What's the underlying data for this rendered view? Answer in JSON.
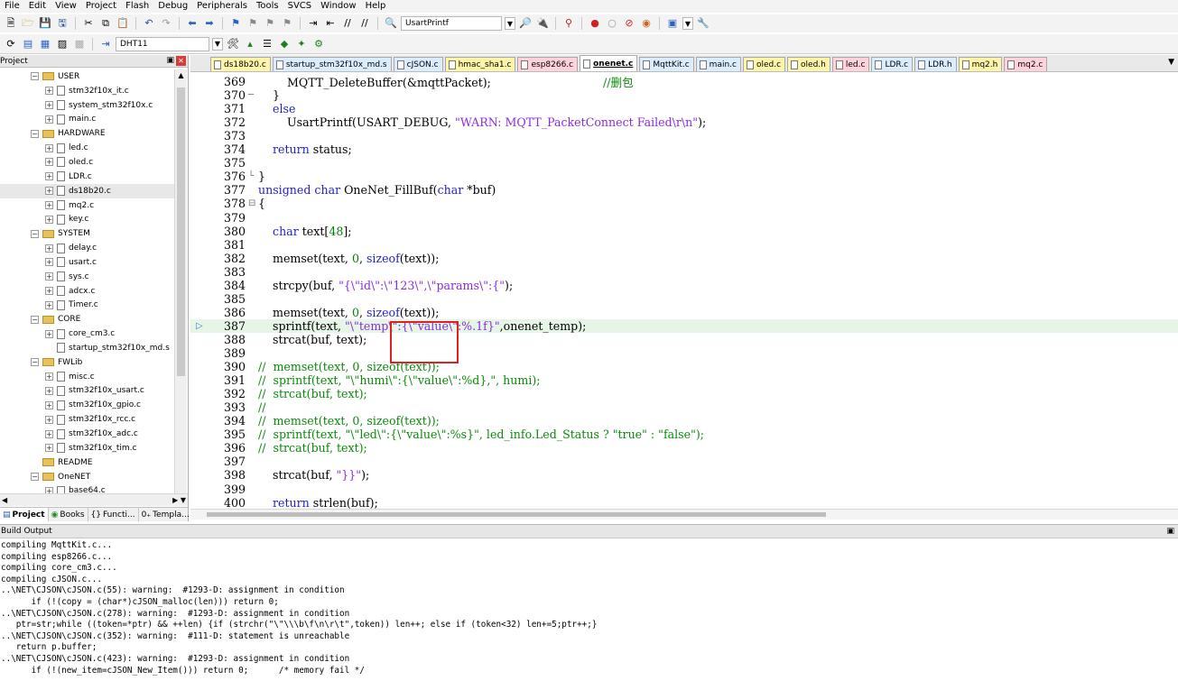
{
  "menu": [
    "File",
    "Edit",
    "View",
    "Project",
    "Flash",
    "Debug",
    "Peripherals",
    "Tools",
    "SVCS",
    "Window",
    "Help"
  ],
  "toolbar": {
    "find_combo": "UsartPrintf",
    "target_combo": "DHT11"
  },
  "project": {
    "title": "Project",
    "tree": [
      {
        "label": "USER",
        "type": "group",
        "level": 0,
        "expander": "−"
      },
      {
        "label": "stm32f10x_it.c",
        "type": "file",
        "level": 1,
        "expander": "+"
      },
      {
        "label": "system_stm32f10x.c",
        "type": "file",
        "level": 1,
        "expander": "+"
      },
      {
        "label": "main.c",
        "type": "file",
        "level": 1,
        "expander": "+"
      },
      {
        "label": "HARDWARE",
        "type": "group",
        "level": 0,
        "expander": "−"
      },
      {
        "label": "led.c",
        "type": "file",
        "level": 1,
        "expander": "+"
      },
      {
        "label": "oled.c",
        "type": "file",
        "level": 1,
        "expander": "+"
      },
      {
        "label": "LDR.c",
        "type": "file",
        "level": 1,
        "expander": "+"
      },
      {
        "label": "ds18b20.c",
        "type": "file",
        "level": 1,
        "expander": "+",
        "selected": true
      },
      {
        "label": "mq2.c",
        "type": "file",
        "level": 1,
        "expander": "+"
      },
      {
        "label": "key.c",
        "type": "file",
        "level": 1,
        "expander": "+"
      },
      {
        "label": "SYSTEM",
        "type": "group",
        "level": 0,
        "expander": "−"
      },
      {
        "label": "delay.c",
        "type": "file",
        "level": 1,
        "expander": "+"
      },
      {
        "label": "usart.c",
        "type": "file",
        "level": 1,
        "expander": "+"
      },
      {
        "label": "sys.c",
        "type": "file",
        "level": 1,
        "expander": "+"
      },
      {
        "label": "adcx.c",
        "type": "file",
        "level": 1,
        "expander": "+"
      },
      {
        "label": "Timer.c",
        "type": "file",
        "level": 1,
        "expander": "+"
      },
      {
        "label": "CORE",
        "type": "group",
        "level": 0,
        "expander": "−"
      },
      {
        "label": "core_cm3.c",
        "type": "file",
        "level": 1,
        "expander": "+"
      },
      {
        "label": "startup_stm32f10x_md.s",
        "type": "file",
        "level": 1,
        "expander": ""
      },
      {
        "label": "FWLib",
        "type": "group",
        "level": 0,
        "expander": "−"
      },
      {
        "label": "misc.c",
        "type": "file",
        "level": 1,
        "expander": "+"
      },
      {
        "label": "stm32f10x_usart.c",
        "type": "file",
        "level": 1,
        "expander": "+"
      },
      {
        "label": "stm32f10x_gpio.c",
        "type": "file",
        "level": 1,
        "expander": "+"
      },
      {
        "label": "stm32f10x_rcc.c",
        "type": "file",
        "level": 1,
        "expander": "+"
      },
      {
        "label": "stm32f10x_adc.c",
        "type": "file",
        "level": 1,
        "expander": "+"
      },
      {
        "label": "stm32f10x_tim.c",
        "type": "file",
        "level": 1,
        "expander": "+"
      },
      {
        "label": "README",
        "type": "group",
        "level": 0,
        "expander": ""
      },
      {
        "label": "OneNET",
        "type": "group",
        "level": 0,
        "expander": "−"
      },
      {
        "label": "base64.c",
        "type": "file",
        "level": 1,
        "expander": "+"
      }
    ],
    "tabs": [
      "Project",
      "Books",
      "Functi...",
      "Templa..."
    ]
  },
  "editor": {
    "tabs": [
      {
        "label": "ds18b20.c",
        "color": "#fff5a8"
      },
      {
        "label": "startup_stm32f10x_md.s",
        "color": "#dcecff"
      },
      {
        "label": "cJSON.c",
        "color": "#dcecff"
      },
      {
        "label": "hmac_sha1.c",
        "color": "#fff5a8"
      },
      {
        "label": "esp8266.c",
        "color": "#ffd2dc"
      },
      {
        "label": "onenet.c",
        "color": "#ffffff",
        "active": true
      },
      {
        "label": "MqttKit.c",
        "color": "#dcecff"
      },
      {
        "label": "main.c",
        "color": "#dcecff"
      },
      {
        "label": "oled.c",
        "color": "#fff5a8"
      },
      {
        "label": "oled.h",
        "color": "#fff5a8"
      },
      {
        "label": "led.c",
        "color": "#ffd2dc"
      },
      {
        "label": "LDR.c",
        "color": "#dcecff"
      },
      {
        "label": "LDR.h",
        "color": "#dcecff"
      },
      {
        "label": "mq2.h",
        "color": "#fff5a8"
      },
      {
        "label": "mq2.c",
        "color": "#ffd2dc"
      }
    ],
    "current_line": 387,
    "lines": [
      {
        "n": "369",
        "fold": "",
        "segs": [
          [
            "        MQTT_DeleteBuffer(&mqttPacket);                               ",
            ""
          ],
          [
            "//删包",
            "cmt"
          ]
        ]
      },
      {
        "n": "370",
        "fold": "─",
        "segs": [
          [
            "    }",
            ""
          ]
        ]
      },
      {
        "n": "371",
        "fold": "",
        "segs": [
          [
            "    ",
            ""
          ],
          [
            "else",
            "kw"
          ]
        ]
      },
      {
        "n": "372",
        "fold": "",
        "segs": [
          [
            "        UsartPrintf(USART_DEBUG, ",
            ""
          ],
          [
            "\"WARN: MQTT_PacketConnect Failed\\r\\n\"",
            "str"
          ],
          [
            ");",
            ""
          ]
        ]
      },
      {
        "n": "373",
        "fold": "",
        "segs": [
          [
            "",
            ""
          ]
        ]
      },
      {
        "n": "374",
        "fold": "",
        "segs": [
          [
            "    ",
            ""
          ],
          [
            "return",
            "kw"
          ],
          [
            " status;",
            ""
          ]
        ]
      },
      {
        "n": "375",
        "fold": "",
        "segs": [
          [
            "",
            ""
          ]
        ]
      },
      {
        "n": "376",
        "fold": "└",
        "segs": [
          [
            "}",
            ""
          ]
        ]
      },
      {
        "n": "377",
        "fold": "",
        "segs": [
          [
            "unsigned char",
            "kw"
          ],
          [
            " OneNet_FillBuf(",
            ""
          ],
          [
            "char",
            "kw"
          ],
          [
            " *buf)",
            ""
          ]
        ]
      },
      {
        "n": "378",
        "fold": "⊟",
        "segs": [
          [
            "{",
            ""
          ]
        ]
      },
      {
        "n": "379",
        "fold": "",
        "segs": [
          [
            "",
            ""
          ]
        ]
      },
      {
        "n": "380",
        "fold": "",
        "segs": [
          [
            "    ",
            ""
          ],
          [
            "char",
            "kw"
          ],
          [
            " text[",
            ""
          ],
          [
            "48",
            "num"
          ],
          [
            "];",
            ""
          ]
        ]
      },
      {
        "n": "381",
        "fold": "",
        "segs": [
          [
            "",
            ""
          ]
        ]
      },
      {
        "n": "382",
        "fold": "",
        "segs": [
          [
            "    memset(text, ",
            ""
          ],
          [
            "0",
            "num"
          ],
          [
            ", ",
            ""
          ],
          [
            "sizeof",
            "kw"
          ],
          [
            "(text));",
            ""
          ]
        ]
      },
      {
        "n": "383",
        "fold": "",
        "segs": [
          [
            "",
            ""
          ]
        ]
      },
      {
        "n": "384",
        "fold": "",
        "segs": [
          [
            "    strcpy(buf, ",
            ""
          ],
          [
            "\"{\\\"id\\\":\\\"123\\\",\\\"params\\\":{\"",
            "str"
          ],
          [
            ");",
            ""
          ]
        ]
      },
      {
        "n": "385",
        "fold": "",
        "segs": [
          [
            "",
            ""
          ]
        ]
      },
      {
        "n": "386",
        "fold": "",
        "segs": [
          [
            "    memset(text, ",
            ""
          ],
          [
            "0",
            "num"
          ],
          [
            ", ",
            ""
          ],
          [
            "sizeof",
            "kw"
          ],
          [
            "(text));",
            ""
          ]
        ]
      },
      {
        "n": "387",
        "fold": "",
        "segs": [
          [
            "    sprintf(text, ",
            ""
          ],
          [
            "\"\\\"temp\\\":{\\\"value\\\":%.1f}\"",
            "str"
          ],
          [
            ",onenet_temp);",
            ""
          ]
        ]
      },
      {
        "n": "388",
        "fold": "",
        "segs": [
          [
            "    strcat(buf, text);",
            ""
          ]
        ]
      },
      {
        "n": "389",
        "fold": "",
        "segs": [
          [
            "",
            ""
          ]
        ]
      },
      {
        "n": "390",
        "fold": "",
        "segs": [
          [
            "//  memset(text, 0, sizeof(text));",
            "cmt"
          ]
        ]
      },
      {
        "n": "391",
        "fold": "",
        "segs": [
          [
            "//  sprintf(text, \"\\\"humi\\\":{\\\"value\\\":%d},\", humi);",
            "cmt"
          ]
        ]
      },
      {
        "n": "392",
        "fold": "",
        "segs": [
          [
            "//  strcat(buf, text);",
            "cmt"
          ]
        ]
      },
      {
        "n": "393",
        "fold": "",
        "segs": [
          [
            "//",
            "cmt"
          ]
        ]
      },
      {
        "n": "394",
        "fold": "",
        "segs": [
          [
            "//  memset(text, 0, sizeof(text));",
            "cmt"
          ]
        ]
      },
      {
        "n": "395",
        "fold": "",
        "segs": [
          [
            "//  sprintf(text, \"\\\"led\\\":{\\\"value\\\":%s}\", led_info.Led_Status ? \"true\" : \"false\");",
            "cmt"
          ]
        ]
      },
      {
        "n": "396",
        "fold": "",
        "segs": [
          [
            "//  strcat(buf, text);",
            "cmt"
          ]
        ]
      },
      {
        "n": "397",
        "fold": "",
        "segs": [
          [
            "",
            ""
          ]
        ]
      },
      {
        "n": "398",
        "fold": "",
        "segs": [
          [
            "    strcat(buf, ",
            ""
          ],
          [
            "\"}}\"",
            "str"
          ],
          [
            ");",
            ""
          ]
        ]
      },
      {
        "n": "399",
        "fold": "",
        "segs": [
          [
            "",
            ""
          ]
        ]
      },
      {
        "n": "400",
        "fold": "",
        "segs": [
          [
            "    ",
            ""
          ],
          [
            "return",
            "kw"
          ],
          [
            " strlen(buf);",
            ""
          ]
        ]
      }
    ]
  },
  "build": {
    "title": "Build Output",
    "lines": [
      "compiling MqttKit.c...",
      "compiling esp8266.c...",
      "compiling core_cm3.c...",
      "compiling cJSON.c...",
      "..\\NET\\CJSON\\cJSON.c(55): warning:  #1293-D: assignment in condition",
      "      if (!(copy = (char*)cJSON_malloc(len))) return 0;",
      "..\\NET\\CJSON\\cJSON.c(278): warning:  #1293-D: assignment in condition",
      "   ptr=str;while ((token=*ptr) && ++len) {if (strchr(\"\\\"\\\\\\b\\f\\n\\r\\t\",token)) len++; else if (token<32) len+=5;ptr++;}",
      "..\\NET\\CJSON\\cJSON.c(352): warning:  #111-D: statement is unreachable",
      "   return p.buffer;",
      "..\\NET\\CJSON\\cJSON.c(423): warning:  #1293-D: assignment in condition",
      "      if (!(new_item=cJSON_New_Item())) return 0;      /* memory fail */"
    ]
  }
}
